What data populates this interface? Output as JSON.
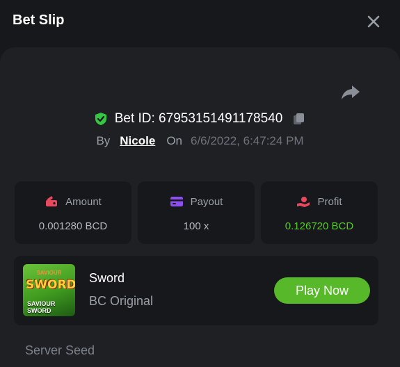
{
  "header": {
    "title": "Bet Slip"
  },
  "bet": {
    "id_label": "Bet ID: 67953151491178540",
    "by_label": "By",
    "user": "Nicole",
    "on_label": "On",
    "datetime": "6/6/2022, 6:47:24 PM"
  },
  "stats": [
    {
      "label": "Amount",
      "value": "0.001280 BCD",
      "icon": "amount-icon",
      "color": "#e8495e"
    },
    {
      "label": "Payout",
      "value": "100 x",
      "icon": "payout-card-icon",
      "color": "#8e4ff0"
    },
    {
      "label": "Profit",
      "value": "0.126720 BCD",
      "icon": "profit-icon",
      "color": "#e8495e",
      "value_color": "#57c82a"
    }
  ],
  "game": {
    "name": "Sword",
    "provider": "BC Original",
    "play_label": "Play Now",
    "thumb_top": "SAVIOUR",
    "thumb_title": "SWORD",
    "thumb_bottom_1": "SAVIOUR",
    "thumb_bottom_2": "SWORD"
  },
  "server_seed_label": "Server Seed",
  "colors": {
    "accent_green": "#57b82a",
    "bg": "#17181b",
    "panel": "#1e2024"
  }
}
